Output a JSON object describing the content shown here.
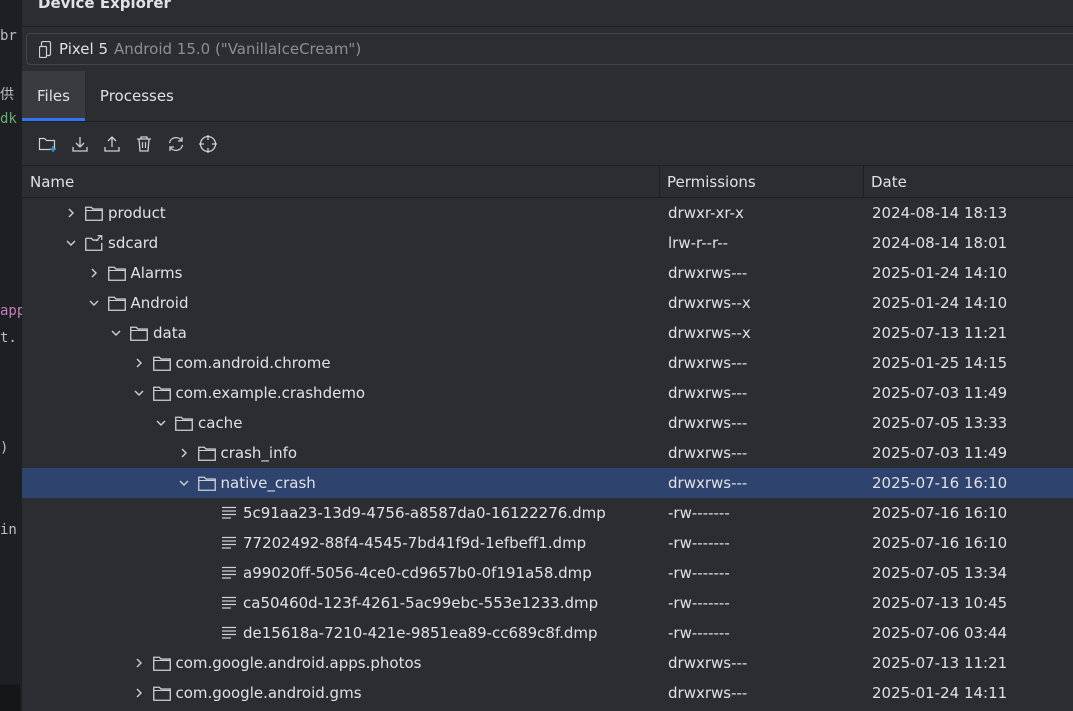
{
  "panel": {
    "title": "Device Explorer"
  },
  "device": {
    "name": "Pixel 5",
    "os": "Android 15.0 (\"VanillaIceCream\")"
  },
  "tabs": [
    {
      "label": "Files",
      "active": true
    },
    {
      "label": "Processes",
      "active": false
    }
  ],
  "toolbar": {
    "buttons": [
      "new-folder-icon",
      "download-icon",
      "upload-icon",
      "delete-icon",
      "sync-icon",
      "locate-icon"
    ]
  },
  "columns": {
    "name": "Name",
    "permissions": "Permissions",
    "date": "Date"
  },
  "rows": [
    {
      "name": "product",
      "type": "folder",
      "depth": 0,
      "expanded": false,
      "permissions": "drwxr-xr-x",
      "date": "2024-08-14 18:13"
    },
    {
      "name": "sdcard",
      "type": "symlink",
      "depth": 0,
      "expanded": true,
      "permissions": "lrw-r--r--",
      "date": "2024-08-14 18:01"
    },
    {
      "name": "Alarms",
      "type": "folder",
      "depth": 1,
      "expanded": false,
      "permissions": "drwxrws---",
      "date": "2025-01-24 14:10"
    },
    {
      "name": "Android",
      "type": "folder",
      "depth": 1,
      "expanded": true,
      "permissions": "drwxrws--x",
      "date": "2025-01-24 14:10"
    },
    {
      "name": "data",
      "type": "folder",
      "depth": 2,
      "expanded": true,
      "permissions": "drwxrws--x",
      "date": "2025-07-13 11:21"
    },
    {
      "name": "com.android.chrome",
      "type": "folder",
      "depth": 3,
      "expanded": false,
      "permissions": "drwxrws---",
      "date": "2025-01-25 14:15"
    },
    {
      "name": "com.example.crashdemo",
      "type": "folder",
      "depth": 3,
      "expanded": true,
      "permissions": "drwxrws---",
      "date": "2025-07-03 11:49"
    },
    {
      "name": "cache",
      "type": "folder",
      "depth": 4,
      "expanded": true,
      "permissions": "drwxrws---",
      "date": "2025-07-05 13:33"
    },
    {
      "name": "crash_info",
      "type": "folder",
      "depth": 5,
      "expanded": false,
      "permissions": "drwxrws---",
      "date": "2025-07-03 11:49"
    },
    {
      "name": "native_crash",
      "type": "folder",
      "depth": 5,
      "expanded": true,
      "selected": true,
      "permissions": "drwxrws---",
      "date": "2025-07-16 16:10"
    },
    {
      "name": "5c91aa23-13d9-4756-a8587da0-16122276.dmp",
      "type": "file",
      "depth": 6,
      "permissions": "-rw-------",
      "date": "2025-07-16 16:10"
    },
    {
      "name": "77202492-88f4-4545-7bd41f9d-1efbeff1.dmp",
      "type": "file",
      "depth": 6,
      "permissions": "-rw-------",
      "date": "2025-07-16 16:10"
    },
    {
      "name": "a99020ff-5056-4ce0-cd9657b0-0f191a58.dmp",
      "type": "file",
      "depth": 6,
      "permissions": "-rw-------",
      "date": "2025-07-05 13:34"
    },
    {
      "name": "ca50460d-123f-4261-5ac99ebc-553e1233.dmp",
      "type": "file",
      "depth": 6,
      "permissions": "-rw-------",
      "date": "2025-07-13 10:45"
    },
    {
      "name": "de15618a-7210-421e-9851ea89-cc689c8f.dmp",
      "type": "file",
      "depth": 6,
      "permissions": "-rw-------",
      "date": "2025-07-06 03:44"
    },
    {
      "name": "com.google.android.apps.photos",
      "type": "folder",
      "depth": 3,
      "expanded": false,
      "permissions": "drwxrws---",
      "date": "2025-07-13 11:21"
    },
    {
      "name": "com.google.android.gms",
      "type": "folder",
      "depth": 3,
      "expanded": false,
      "permissions": "drwxrws---",
      "date": "2025-01-24 14:11"
    }
  ],
  "editor_fragments": [
    {
      "text": "br",
      "color": "#bcbec4"
    },
    {
      "text": "供",
      "color": "#bcbec4"
    },
    {
      "text": "dk",
      "color": "#6aab73"
    },
    {
      "text": "app",
      "color": "#c77dbb"
    },
    {
      "text": "t.",
      "color": "#bcbec4"
    },
    {
      "text": ")",
      "color": "#bcbec4"
    },
    {
      "text": "in",
      "color": "#bcbec4"
    }
  ],
  "colors": {
    "accent": "#3574f0",
    "selection": "#2e436e",
    "background": "#2b2d30"
  }
}
